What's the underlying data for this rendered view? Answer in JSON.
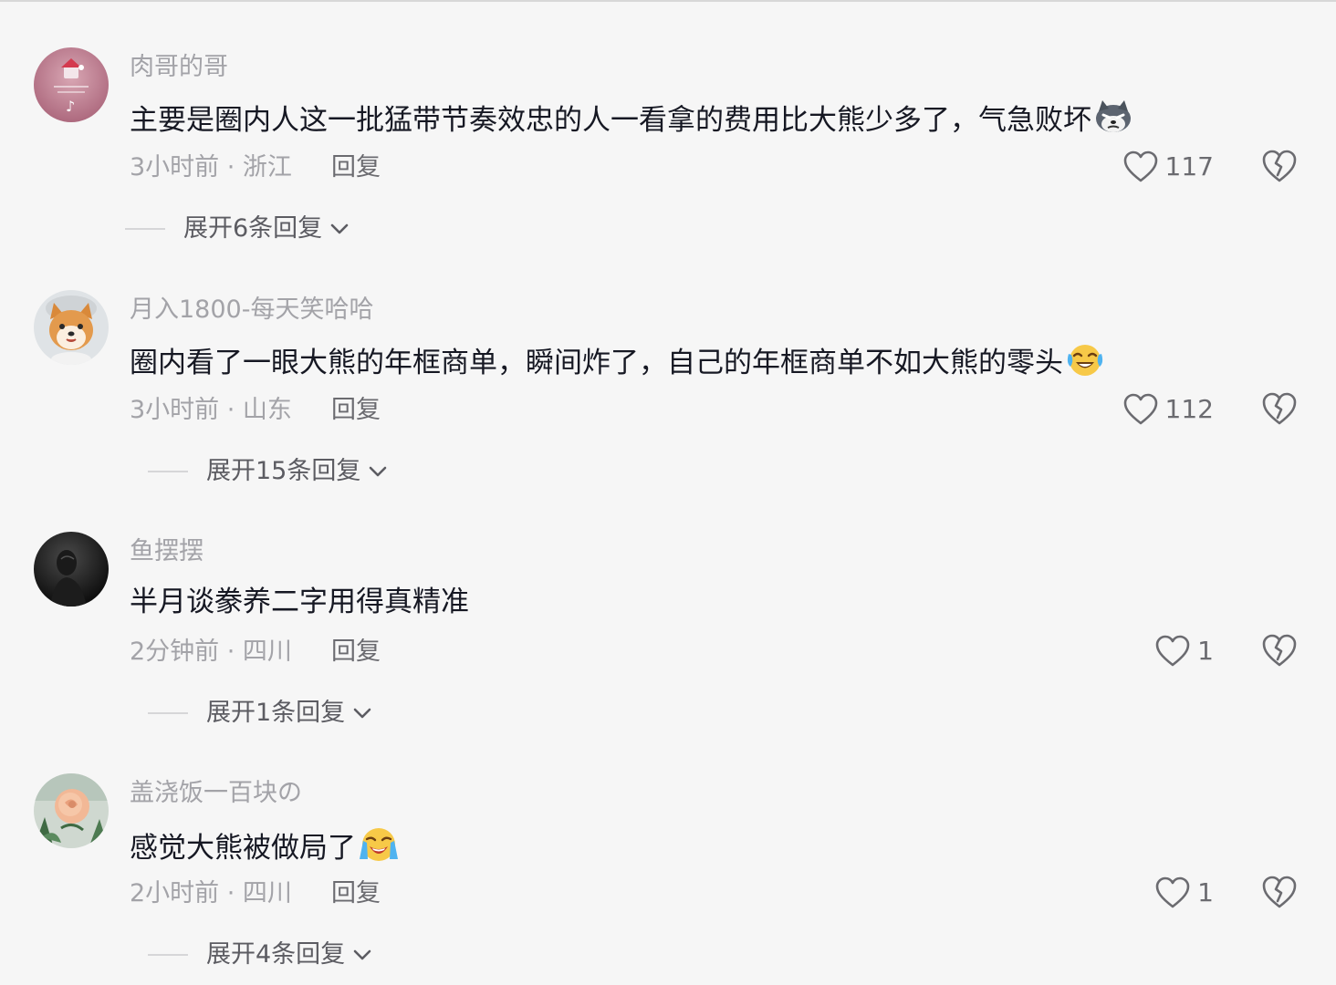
{
  "comments": [
    {
      "username": "肉哥的哥",
      "text": "主要是圈内人这一批猛带节奏效忠的人一看拿的费用比大熊少多了，气急败坏",
      "emoji": "dog-face-emoji",
      "time_location": "3小时前 · 浙江",
      "reply_label": "回复",
      "likes": "117",
      "expand_label": "展开6条回复",
      "avatar_icon": "pink-logo-avatar"
    },
    {
      "username": "月入1800-每天笑哈哈",
      "text": "圈内看了一眼大熊的年框商单，瞬间炸了，自己的年框商单不如大熊的零头",
      "emoji": "crying-laughing-emoji",
      "time_location": "3小时前 · 山东",
      "reply_label": "回复",
      "likes": "112",
      "expand_label": "展开15条回复",
      "avatar_icon": "shiba-dog-avatar"
    },
    {
      "username": "鱼摆摆",
      "text": "半月谈豢养二字用得真精准",
      "emoji": "",
      "time_location": "2分钟前 · 四川",
      "reply_label": "回复",
      "likes": "1",
      "expand_label": "展开1条回复",
      "avatar_icon": "dark-silhouette-avatar"
    },
    {
      "username": "盖浇饭一百块の",
      "text": "感觉大熊被做局了",
      "emoji": "loudly-crying-emoji",
      "time_location": "2小时前 · 四川",
      "reply_label": "回复",
      "likes": "1",
      "expand_label": "展开4条回复",
      "avatar_icon": "rose-flower-avatar"
    }
  ],
  "colors": {
    "background": "#f6f6f6",
    "text": "#161823",
    "secondary": "#a3a3a8",
    "action": "#6b6b70"
  },
  "icons": {
    "like": "heart-outline-icon",
    "dislike": "broken-heart-icon",
    "expand": "chevron-down-icon"
  }
}
